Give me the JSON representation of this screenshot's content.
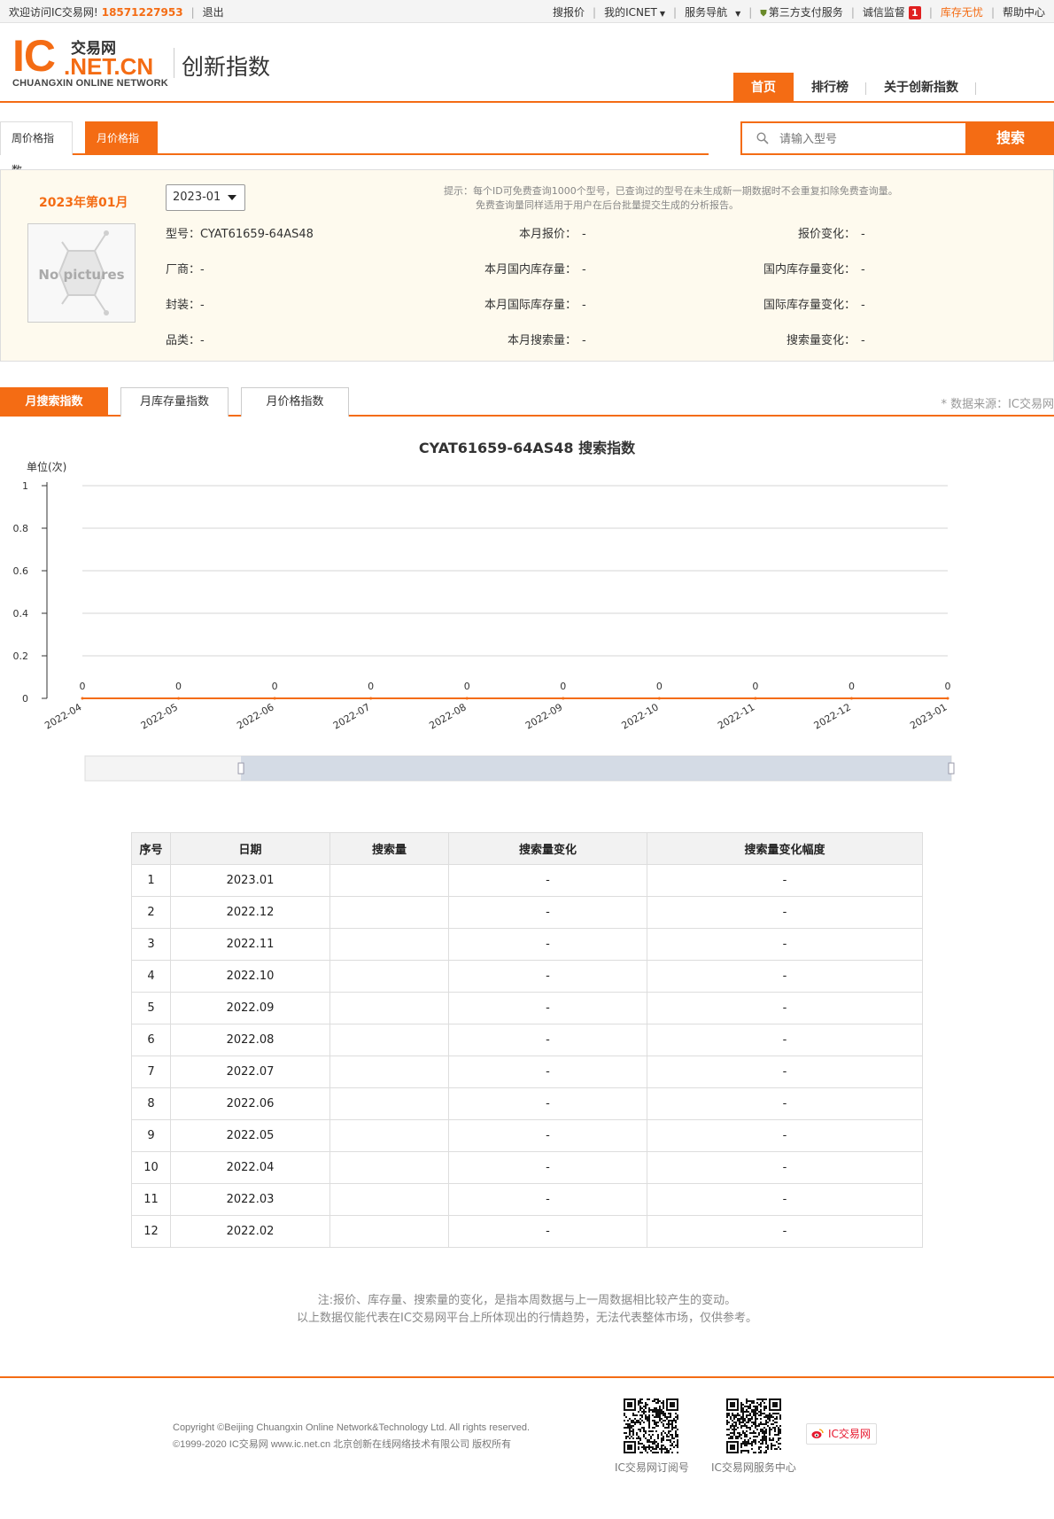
{
  "topbar": {
    "welcome": "欢迎访问IC交易网!",
    "phone": "18571227953",
    "logout": "退出",
    "links": [
      "搜报价",
      "我的ICNET",
      "服务导航",
      "第三方支付服务",
      "诚信监督",
      "库存无忧",
      "帮助中心"
    ],
    "badge": "1"
  },
  "header": {
    "logo_ic": "IC",
    "logo_cn": "交易网",
    "logo_net": ".NET.CN",
    "logo_sub": "CHUANGXIN ONLINE NETWORK",
    "title": "创新指数",
    "nav": [
      "首页",
      "排行榜",
      "关于创新指数"
    ]
  },
  "subtabs": [
    "周价格指数",
    "月价格指数"
  ],
  "search": {
    "placeholder": "请输入型号",
    "button": "搜索"
  },
  "info": {
    "period": "2023年第01月",
    "select_value": "2023-01",
    "hint_1": "提示：每个ID可免费查询1000个型号，已查询过的型号在未生成新一期数据时不会重复扣除免费查询量。",
    "hint_2": "免费查询量同样适用于用户在后台批量提交生成的分析报告。",
    "nopic": "No pictures",
    "fields": {
      "model_label": "型号：",
      "model_value": "CYAT61659-64AS48",
      "maker_label": "厂商：",
      "maker_value": "-",
      "package_label": "封装：",
      "package_value": "-",
      "category_label": "品类：",
      "category_value": "-",
      "price_label": "本月报价：",
      "price_value": "-",
      "dom_stock_label": "本月国内库存量：",
      "dom_stock_value": "-",
      "intl_stock_label": "本月国际库存量：",
      "intl_stock_value": "-",
      "search_label": "本月搜索量：",
      "search_value": "-",
      "price_chg_label": "报价变化：",
      "price_chg_value": "-",
      "dom_chg_label": "国内库存量变化：",
      "dom_chg_value": "-",
      "intl_chg_label": "国际库存量变化：",
      "intl_chg_value": "-",
      "search_chg_label": "搜索量变化：",
      "search_chg_value": "-"
    }
  },
  "chart_tabs": [
    "月搜索指数",
    "月库存量指数",
    "月价格指数"
  ],
  "source": "* 数据来源：IC交易网",
  "chart_data": {
    "type": "line",
    "title": "CYAT61659-64AS48 搜索指数",
    "ylabel": "单位(次)",
    "xlabel": "",
    "categories": [
      "2022-04",
      "2022-05",
      "2022-06",
      "2022-07",
      "2022-08",
      "2022-09",
      "2022-10",
      "2022-11",
      "2022-12",
      "2023-01"
    ],
    "series": [
      {
        "values": [
          0,
          0,
          0,
          0,
          0,
          0,
          0,
          0,
          0,
          0
        ]
      }
    ],
    "ylim": [
      0,
      1
    ],
    "yticks": [
      "0",
      "0.2",
      "0.4",
      "0.6",
      "0.8",
      "1"
    ],
    "grid": true,
    "line_color": "#f46c14",
    "slider_range": [
      0.18,
      1.0
    ]
  },
  "table": {
    "headers": [
      "序号",
      "日期",
      "搜索量",
      "搜索量变化",
      "搜索量变化幅度"
    ],
    "rows": [
      [
        "1",
        "2023.01",
        "",
        "-",
        "-"
      ],
      [
        "2",
        "2022.12",
        "",
        "-",
        "-"
      ],
      [
        "3",
        "2022.11",
        "",
        "-",
        "-"
      ],
      [
        "4",
        "2022.10",
        "",
        "-",
        "-"
      ],
      [
        "5",
        "2022.09",
        "",
        "-",
        "-"
      ],
      [
        "6",
        "2022.08",
        "",
        "-",
        "-"
      ],
      [
        "7",
        "2022.07",
        "",
        "-",
        "-"
      ],
      [
        "8",
        "2022.06",
        "",
        "-",
        "-"
      ],
      [
        "9",
        "2022.05",
        "",
        "-",
        "-"
      ],
      [
        "10",
        "2022.04",
        "",
        "-",
        "-"
      ],
      [
        "11",
        "2022.03",
        "",
        "-",
        "-"
      ],
      [
        "12",
        "2022.02",
        "",
        "-",
        "-"
      ]
    ]
  },
  "notes": [
    "注:报价、库存量、搜索量的变化，是指本周数据与上一周数据相比较产生的变动。",
    "以上数据仅能代表在IC交易网平台上所体现出的行情趋势，无法代表整体市场，仅供参考。"
  ],
  "footer": {
    "copy_1": "Copyright ©Beijing Chuangxin Online Network&Technology Ltd. All rights reserved.",
    "copy_2": "©1999-2020 IC交易网 www.ic.net.cn 北京创新在线网络技术有限公司 版权所有",
    "qr_labels": [
      "IC交易网订阅号",
      "IC交易网服务中心"
    ],
    "weibo": "IC交易网"
  },
  "colors": {
    "accent": "#f46c14",
    "info_bg": "#fefaee",
    "badge": "#e02020"
  }
}
